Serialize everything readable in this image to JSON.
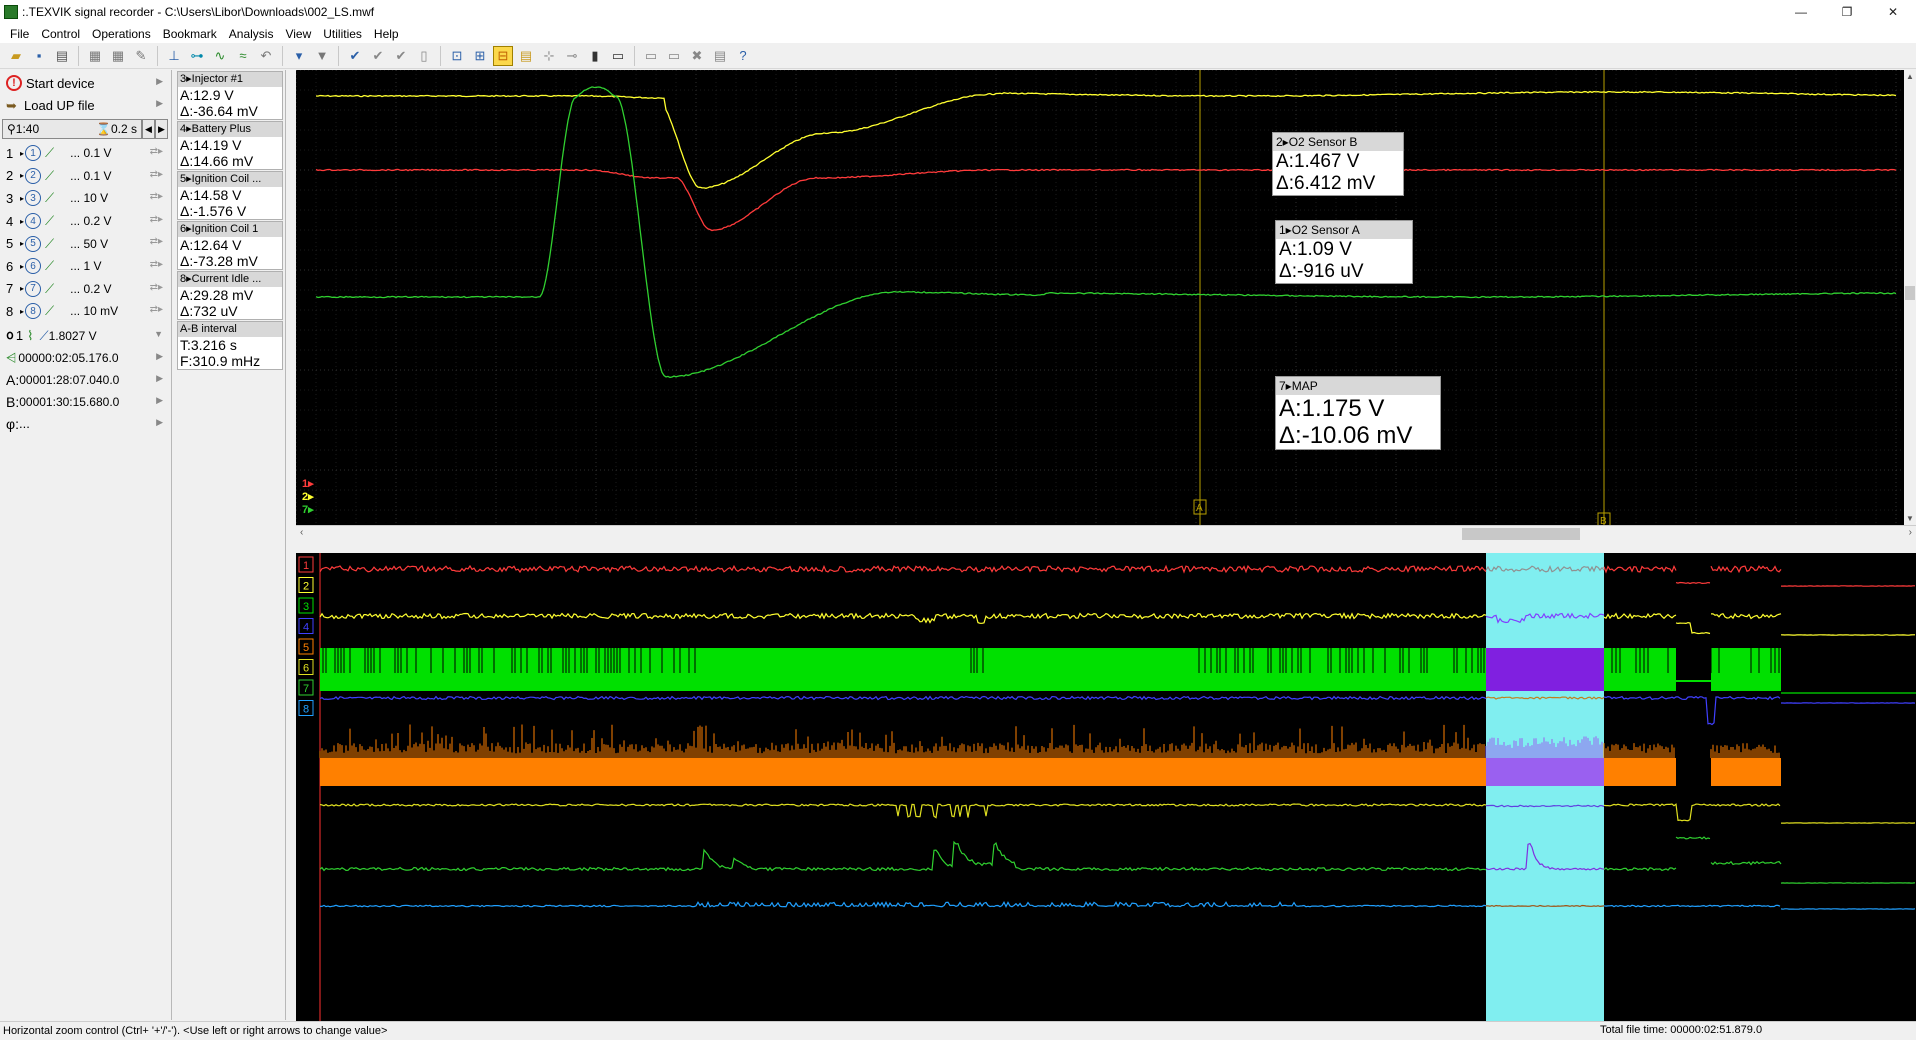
{
  "titlebar": {
    "title": ":.TEXVIK  signal recorder - C:\\Users\\Libor\\Downloads\\002_LS.mwf",
    "minimize": "—",
    "restore": "❐",
    "close": "✕"
  },
  "menu": [
    "File",
    "Control",
    "Operations",
    "Bookmark",
    "Analysis",
    "View",
    "Utilities",
    "Help"
  ],
  "left_panel": {
    "start_device": "Start device",
    "load_file": "Load UP file",
    "zoom_h": "1:40",
    "zoom_t": "0.2 s",
    "channels": [
      {
        "num": "1",
        "scale": "... 0.1 V"
      },
      {
        "num": "2",
        "scale": "... 0.1 V"
      },
      {
        "num": "3",
        "scale": "... 10 V"
      },
      {
        "num": "4",
        "scale": "... 0.2 V"
      },
      {
        "num": "5",
        "scale": "... 50 V"
      },
      {
        "num": "6",
        "scale": "... 1 V"
      },
      {
        "num": "7",
        "scale": "... 0.2 V"
      },
      {
        "num": "8",
        "scale": "... 10 mV"
      }
    ],
    "trigger": "1.8027 V",
    "trigger_ch": "1",
    "pretrig_time": "00000:02:05.176.0",
    "cursor_a": "00001:28:07.040.0",
    "cursor_b": "00001:30:15.680.0",
    "phi": "...",
    "a_label": "A:",
    "b_label": "B:",
    "phi_label": "φ:"
  },
  "measurements": [
    {
      "name": "3▸Injector #1",
      "a": "A:12.9 V",
      "d": "Δ:-36.64 mV"
    },
    {
      "name": "4▸Battery Plus",
      "a": "A:14.19 V",
      "d": "Δ:14.66 mV"
    },
    {
      "name": "5▸Ignition Coil ...",
      "a": "A:14.58 V",
      "d": "Δ:-1.576 V"
    },
    {
      "name": "6▸Ignition Coil 1",
      "a": "A:12.64 V",
      "d": "Δ:-73.28 mV"
    },
    {
      "name": "8▸Current Idle ...",
      "a": "A:29.28 mV",
      "d": "Δ:732 uV"
    },
    {
      "name": "A-B interval",
      "a": "T:3.216 s",
      "d": "F:310.9 mHz"
    }
  ],
  "scope_boxes": {
    "o2b": {
      "name": "2▸O2 Sensor B",
      "a": "A:1.467 V",
      "d": "Δ:6.412 mV"
    },
    "o2a": {
      "name": "1▸O2 Sensor A",
      "a": "A:1.09 V",
      "d": "Δ:-916 uV"
    },
    "map": {
      "name": "7▸MAP",
      "a": "A:1.175 V",
      "d": "Δ:-10.06 mV"
    }
  },
  "scope_markers": {
    "ch1": "1▸",
    "ch2": "2▸",
    "ch7": "7▸",
    "cursor_a": "A",
    "cursor_b": "B"
  },
  "lower_channels": [
    "1",
    "2",
    "3",
    "4",
    "5",
    "6",
    "7",
    "8"
  ],
  "colors": {
    "ch1": "#ff3b3b",
    "ch2": "#ffff30",
    "ch3": "#00e000",
    "ch4": "#4040ff",
    "ch5": "#ff8000",
    "ch6": "#e0e020",
    "ch7": "#30d030",
    "ch8": "#20a0ff",
    "selection": "#80eef0",
    "cursor": "#c8b400"
  },
  "status": {
    "left": "Horizontal zoom control (Ctrl+ '+'/'-'). <Use left or right arrows to change value>",
    "right": "Total file time: 00000:02:51.879.0"
  }
}
